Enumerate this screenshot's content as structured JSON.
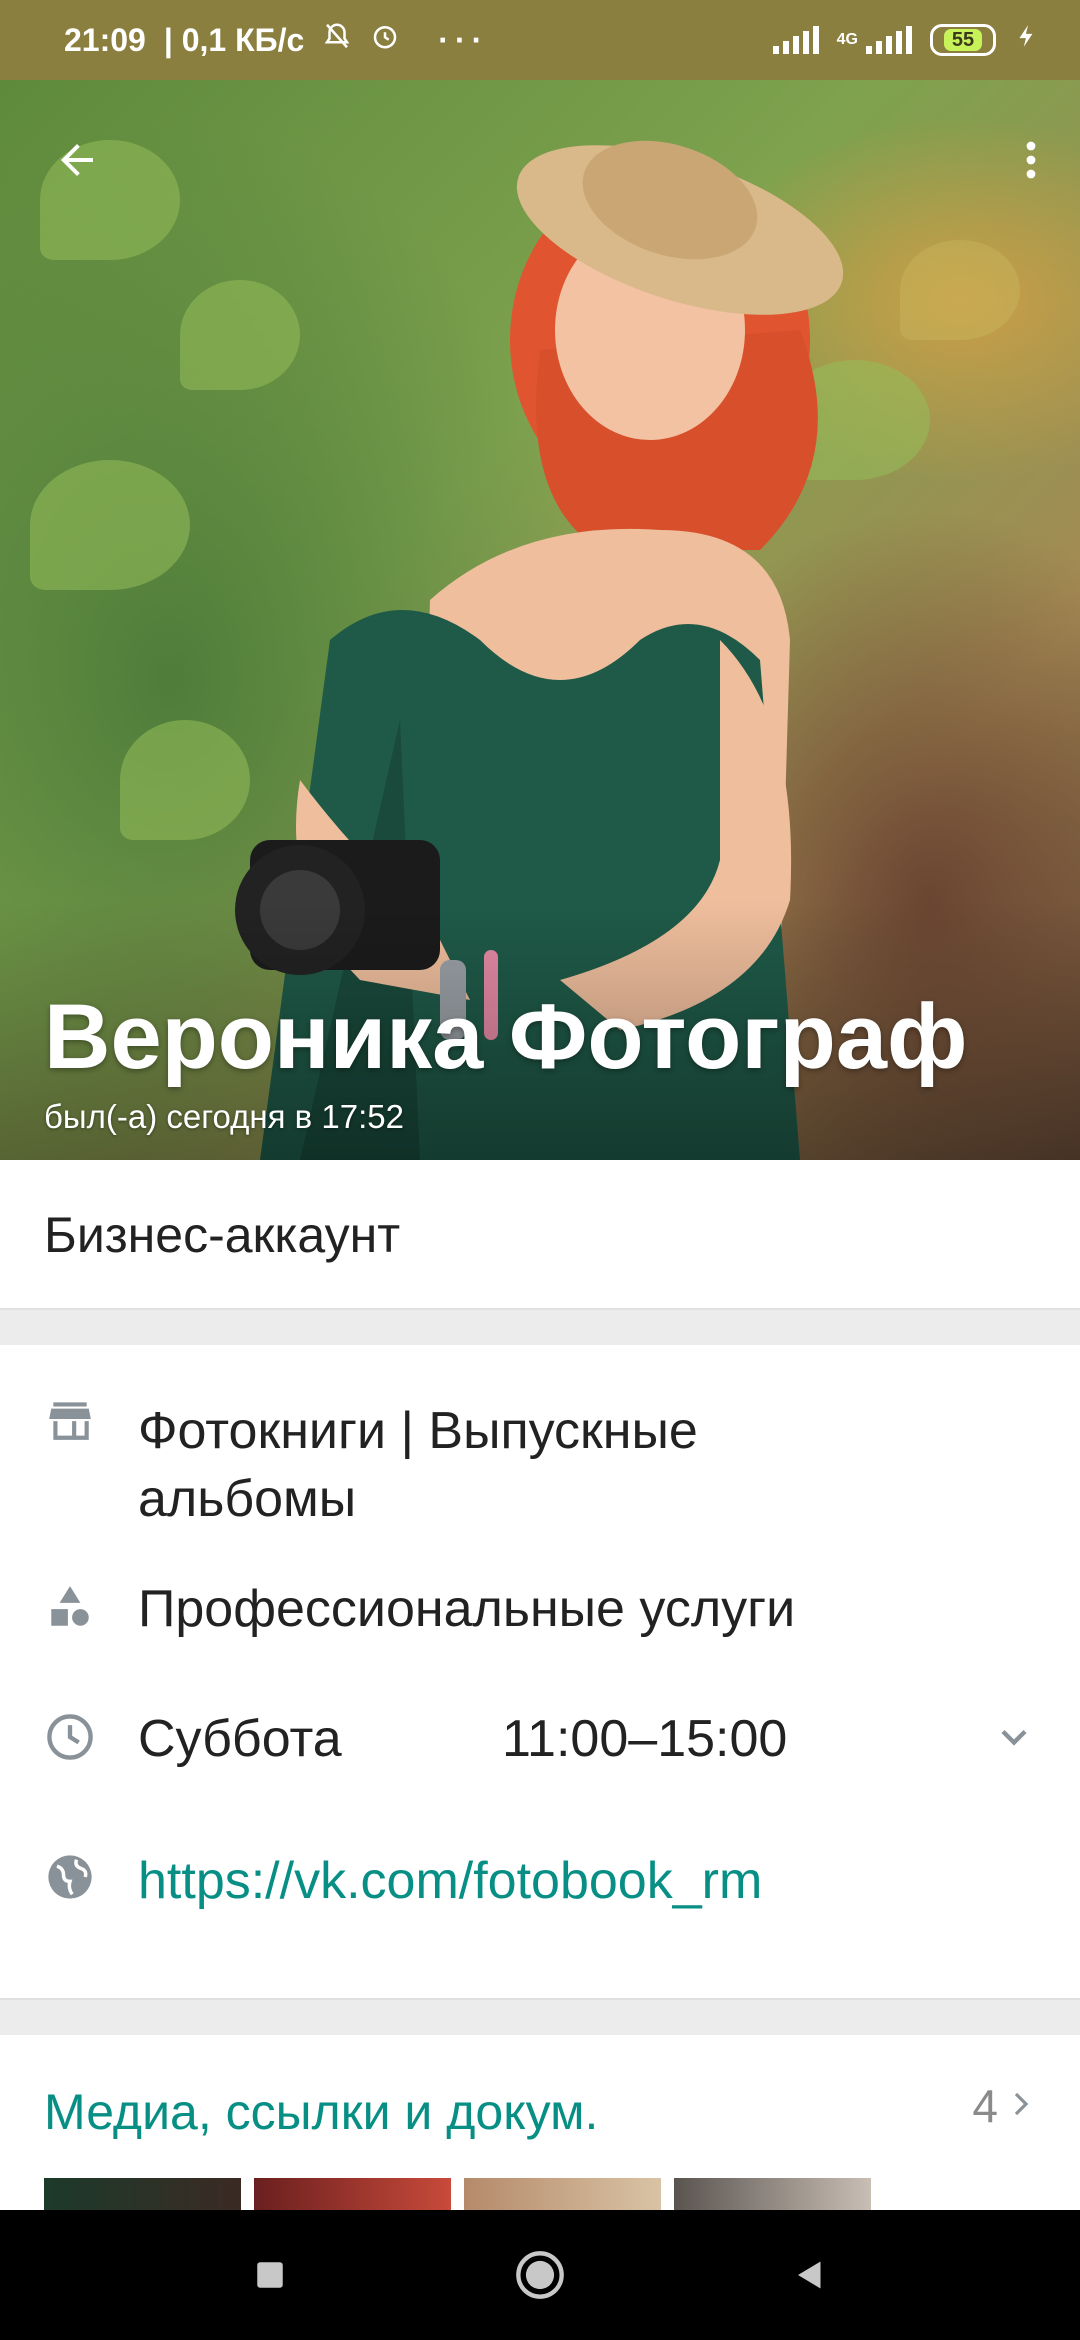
{
  "status_bar": {
    "time": "21:09",
    "speed": "| 0,1 КБ/с",
    "dots": "···",
    "network": "4G",
    "battery": "55",
    "background_color": "#8b7f3f"
  },
  "header": {
    "back_icon": "arrow-left-icon",
    "menu_icon": "more-vertical-icon",
    "name": "Вероника Фотограф",
    "last_seen": "был(-а) сегодня в 17:52"
  },
  "business": {
    "label": "Бизнес-аккаунт"
  },
  "info": {
    "description_line1": "Фотокниги | Выпускные",
    "description_line2": "альбомы",
    "category": "Профессиональные услуги",
    "hours_day": "Суббота",
    "hours_time": "11:00–15:00",
    "website": "https://vk.com/fotobook_rm",
    "accent_color": "#078f85"
  },
  "media": {
    "title": "Медиа, ссылки и докум.",
    "count": "4"
  }
}
